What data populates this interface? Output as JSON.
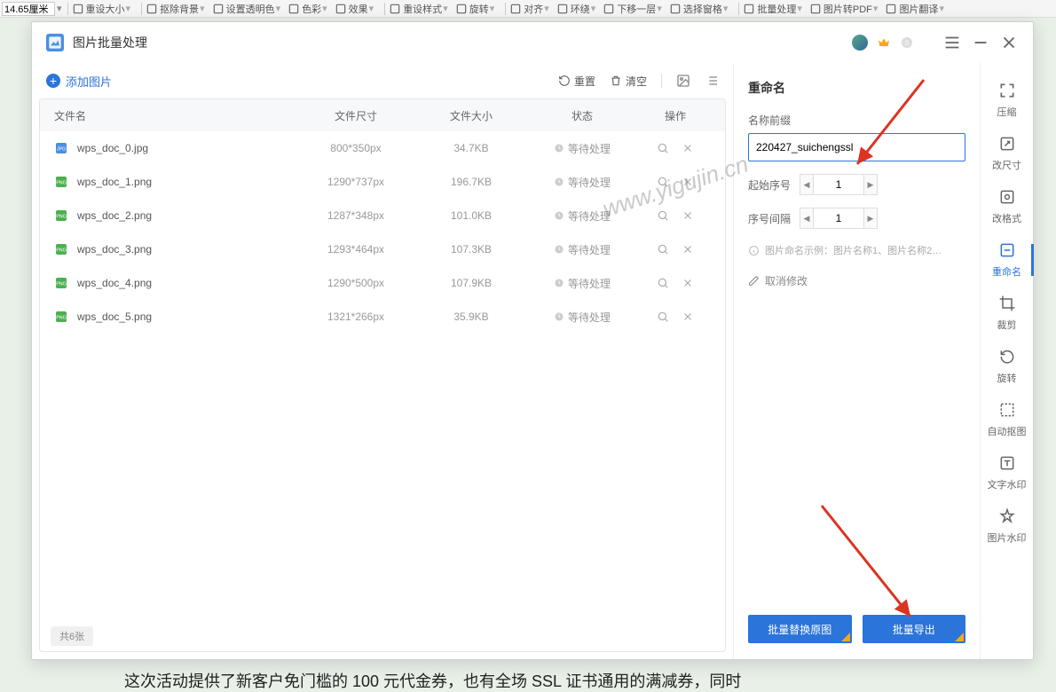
{
  "top_toolbar": {
    "size_value": "14.65厘米",
    "items": [
      "重设大小",
      "抠除背景",
      "设置透明色",
      "色彩",
      "效果",
      "重设样式",
      "旋转",
      "对齐",
      "环绕",
      "下移一层",
      "选择窗格",
      "批量处理",
      "图片转PDF",
      "图片翻译"
    ]
  },
  "modal": {
    "title": "图片批量处理",
    "left_toolbar": {
      "add": "添加图片",
      "reset": "重置",
      "clear": "清空"
    },
    "table": {
      "headers": {
        "name": "文件名",
        "dim": "文件尺寸",
        "size": "文件大小",
        "status": "状态",
        "op": "操作"
      },
      "rows": [
        {
          "name": "wps_doc_0.jpg",
          "type": "jpg",
          "dim": "800*350px",
          "size": "34.7KB",
          "status": "等待处理"
        },
        {
          "name": "wps_doc_1.png",
          "type": "png",
          "dim": "1290*737px",
          "size": "196.7KB",
          "status": "等待处理"
        },
        {
          "name": "wps_doc_2.png",
          "type": "png",
          "dim": "1287*348px",
          "size": "101.0KB",
          "status": "等待处理"
        },
        {
          "name": "wps_doc_3.png",
          "type": "png",
          "dim": "1293*464px",
          "size": "107.3KB",
          "status": "等待处理"
        },
        {
          "name": "wps_doc_4.png",
          "type": "png",
          "dim": "1290*500px",
          "size": "107.9KB",
          "status": "等待处理"
        },
        {
          "name": "wps_doc_5.png",
          "type": "png",
          "dim": "1321*266px",
          "size": "35.9KB",
          "status": "等待处理"
        }
      ],
      "count": "共6张"
    },
    "right": {
      "title": "重命名",
      "prefix_label": "名称前缀",
      "prefix_value": "220427_suichengssl",
      "start_label": "起始序号",
      "start_value": "1",
      "interval_label": "序号间隔",
      "interval_value": "1",
      "hint": "图片命名示例：图片名称1、图片名称2…",
      "cancel": "取消修改",
      "batch_replace": "批量替换原图",
      "batch_export": "批量导出"
    },
    "sidebar": [
      {
        "key": "compress",
        "label": "压缩"
      },
      {
        "key": "resize",
        "label": "改尺寸"
      },
      {
        "key": "format",
        "label": "改格式"
      },
      {
        "key": "rename",
        "label": "重命名",
        "active": true
      },
      {
        "key": "crop",
        "label": "裁剪"
      },
      {
        "key": "rotate",
        "label": "旋转"
      },
      {
        "key": "cutout",
        "label": "自动抠图"
      },
      {
        "key": "textwm",
        "label": "文字水印"
      },
      {
        "key": "imagewm",
        "label": "图片水印"
      }
    ]
  },
  "watermark": "www.yigujin.cn",
  "page_text": "这次活动提供了新客户免门槛的 100 元代金券，也有全场 SSL 证书通用的满减券，同时"
}
